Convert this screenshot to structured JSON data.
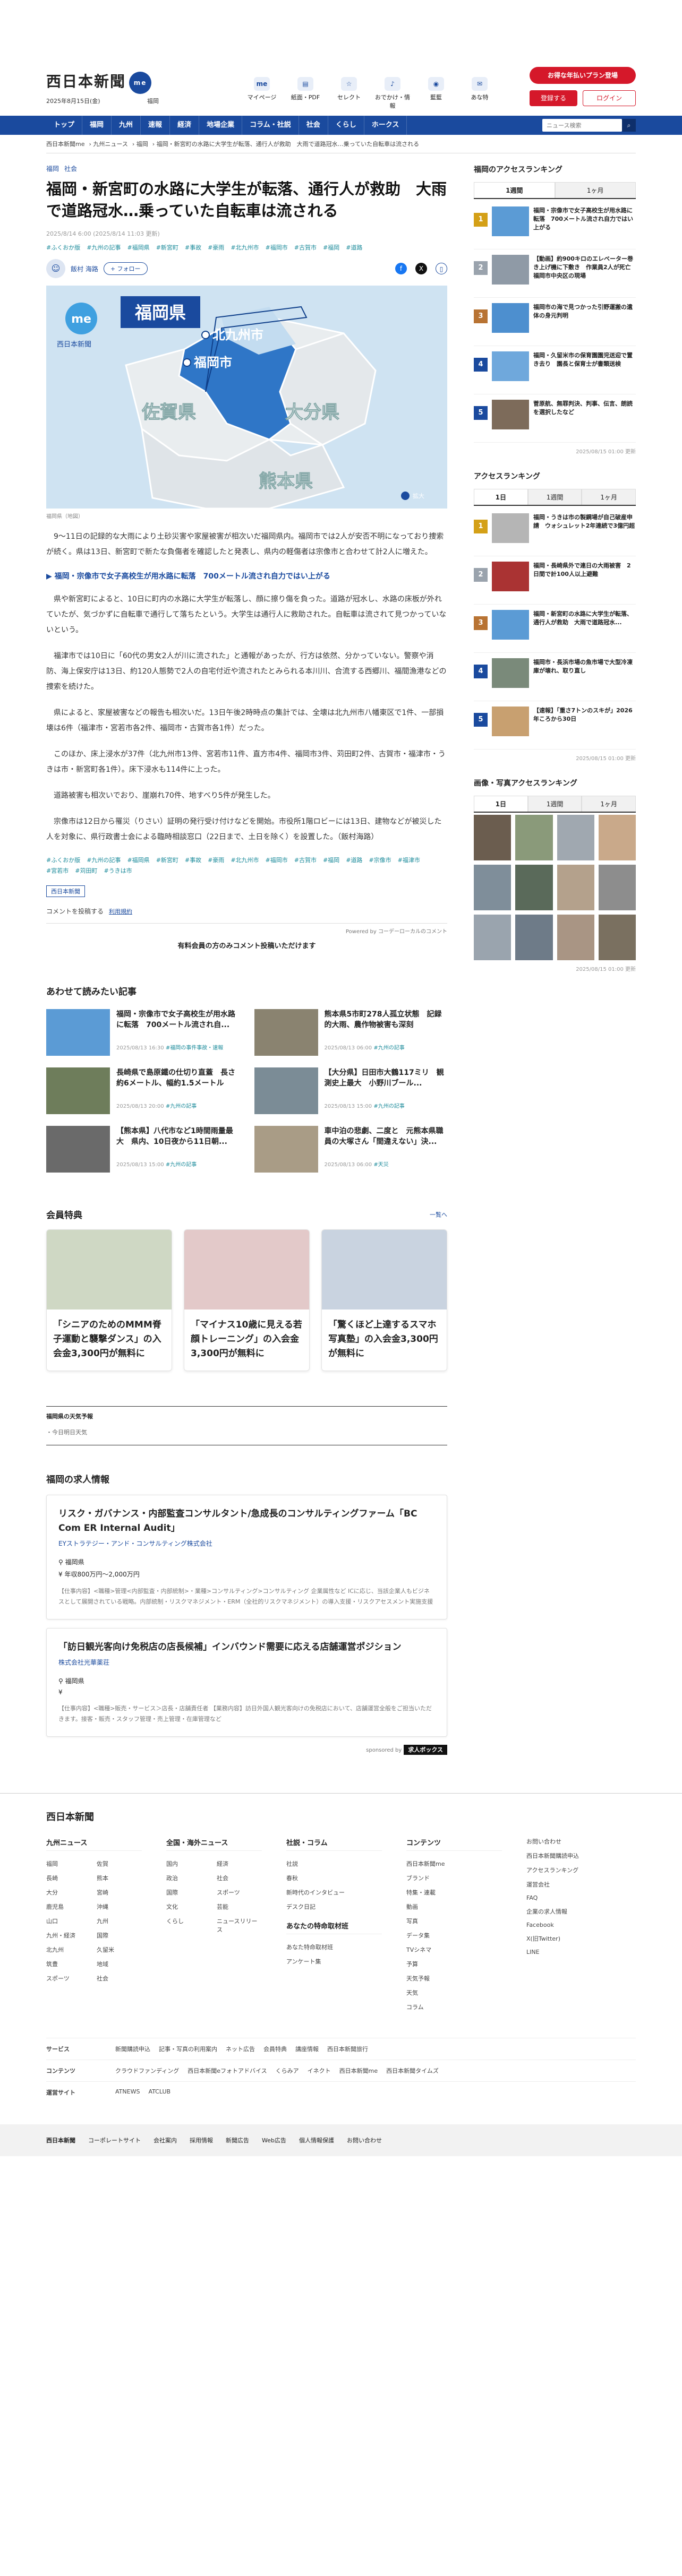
{
  "header": {
    "logo": "西日本新聞",
    "badge": "me",
    "date": "2025年8月15日(金)",
    "weather": "福岡",
    "icons": [
      {
        "label": "マイページ",
        "glyph": "me"
      },
      {
        "label": "紙面・PDF",
        "glyph": "▤"
      },
      {
        "label": "セレクト",
        "glyph": "☆"
      },
      {
        "label": "おでかけ・情報",
        "glyph": "♪"
      },
      {
        "label": "藍藍",
        "glyph": "◉"
      },
      {
        "label": "あな特",
        "glyph": "✉"
      }
    ],
    "cta": "お得な年払いプラン登場",
    "register": "登録する",
    "login": "ログイン"
  },
  "nav": {
    "items": [
      "トップ",
      "福岡",
      "九州",
      "速報",
      "経済",
      "地場企業",
      "コラム・社説",
      "社会",
      "くらし",
      "ホークス"
    ],
    "search_placeholder": "ニュース検索"
  },
  "breadcrumb": [
    "西日本新聞me",
    "九州ニュース",
    "福岡",
    "福岡・新宮町の水路に大学生が転落、通行人が救助　大雨で道路冠水…乗っていた自転車は流される"
  ],
  "article": {
    "categories": [
      "福岡",
      "社会"
    ],
    "title": "福岡・新宮町の水路に大学生が転落、通行人が救助　大雨で道路冠水…乗っていた自転車は流される",
    "pubdate": "2025/8/14 6:00 (2025/8/14 11:03 更新)",
    "tags": [
      "#ふくおか版",
      "#九州の記事",
      "#福岡県",
      "#新宮町",
      "#事故",
      "#豪雨",
      "#北九州市",
      "#福岡市",
      "#古賀市",
      "#福岡",
      "#道路"
    ],
    "author": "飯村 海路",
    "follow": "+ フォロー",
    "map": {
      "labels": [
        "福岡県",
        "北九州市",
        "福岡市",
        "佐賀県",
        "大分県",
        "熊本県"
      ],
      "caption_brand": "me 西日本新聞",
      "zoom": "拡大"
    },
    "caption": "福岡県（地図）",
    "p1": "9〜11日の記録的な大雨により土砂災害や家屋被害が相次いだ福岡県内。福岡市では2人が安否不明になっており捜索が続く。県は13日、新宮町で新たな負傷者を確認したと発表し、県内の軽傷者は宗像市と合わせて計2人に増えた。",
    "rel": "▶ 福岡・宗像市で女子高校生が用水路に転落　700メートル流され自力ではい上がる",
    "p2": "県や新宮町によると、10日に町内の水路に大学生が転落し、顔に擦り傷を負った。道路が冠水し、水路の床板が外れていたが、気づかずに自転車で通行して落ちたという。大学生は通行人に救助された。自転車は流されて見つかっていないという。",
    "p3": "福津市では10日に「60代の男女2人が川に流された」と通報があったが、行方は依然、分かっていない。警察や消防、海上保安庁は13日、約120人態勢で2人の自宅付近や流されたとみられる本川川、合流する西郷川、福間漁港などの捜索を続けた。",
    "p4": "県によると、家屋被害などの報告も相次いだ。13日午後2時時点の集計では、全壊は北九州市八幡東区で1件、一部損壊は6件（福津市・宮若市各2件、福岡市・古賀市各1件）だった。",
    "p5": "このほか、床上浸水が37件（北九州市13件、宮若市11件、直方市4件、福岡市3件、苅田町2件、古賀市・福津市・うきは市・新宮町各1件）。床下浸水も114件に上った。",
    "p6": "道路被害も相次いでおり、崖崩れ70件、地すべり5件が発生した。",
    "p7": "宗像市は12日から罹災（りさい）証明の発行受け付けなどを開始。市役所1階ロビーには13日、建物などが被災した人を対象に、県行政書士会による臨時相談窓口（22日まで、土日を除く）を設置した。（飯村海路）",
    "tags2": [
      "#ふくおか版",
      "#九州の記事",
      "#福岡県",
      "#新宮町",
      "#事故",
      "#豪雨",
      "#北九州市",
      "#福岡市",
      "#古賀市",
      "#福岡",
      "#道路",
      "#宗像市",
      "#福津市",
      "#宮若市",
      "#苅田町",
      "#うきは市"
    ],
    "tagbox": "西日本新聞",
    "comment": "コメントを投稿する",
    "comment_link": "利用規約",
    "powered": "Powered by コーデーローカルのコメント",
    "comment_note": "有料会員の方のみコメント投稿いただけます"
  },
  "related": {
    "heading": "あわせて読みたい記事",
    "items": [
      {
        "title": "福岡・宗像市で女子高校生が用水路に転落　700メートル流され自...",
        "date": "2025/08/13 16:30",
        "tag": "#福岡の事件事故・速報"
      },
      {
        "title": "熊本県5市町278人孤立状態　記録的大雨、農作物被害も深刻",
        "date": "2025/08/13 06:00",
        "tag": "#九州の記事"
      },
      {
        "title": "長崎県で島原鐵の仕切り直蓋　長さ約6メートル、幅約1.5メートル",
        "date": "2025/08/13 20:00",
        "tag": "#九州の記事"
      },
      {
        "title": "【大分県】日田市大鶴117ミリ　観測史上最大　小野川ブール...",
        "date": "2025/08/13 15:00",
        "tag": "#九州の記事"
      },
      {
        "title": "【熊本県】八代市など1時間雨量最大　県内、10日夜から11日朝...",
        "date": "2025/08/13 15:00",
        "tag": "#九州の記事"
      },
      {
        "title": "車中泊の悲劇、二度と　元熊本県職員の大塚さん「間違えない」決...",
        "date": "2025/08/13 06:00",
        "tag": "#天災"
      }
    ]
  },
  "members": {
    "heading": "会員特典",
    "more": "一覧へ",
    "items": [
      "「シニアのためのMMM脊子運動と襲撃ダンス」の入会金3,300円が無料に",
      "「マイナス10歳に見える若顔トレーニング」の入会金3,300円が無料に",
      "「驚くほど上達するスマホ写真塾」の入会金3,300円が無料に"
    ]
  },
  "weather": {
    "heading": "福岡県の天気予報",
    "text": "・今日明日天気"
  },
  "jobs": {
    "heading": "福岡の求人情報",
    "items": [
      {
        "title": "リスク・ガバナンス・内部監査コンサルタント/急成長のコンサルティングファーム「BC Com ER Internal Audit」",
        "company": "EYストラテジー・アンド・コンサルティング株式会社",
        "loc": "福岡県",
        "pay": "年収800万円〜2,000万円",
        "desc": "【仕事内容】<職種>管理<内部監査・内部統制>・業種>コンサルティング>コンサルティング 企業属性など ICに応じ、当該企業人もビジネスとして展開されている戦略。内部統制・リスクマネジメント・ERM（全社的リスクマネジメント）の導入支援・リスクアセスメント実施支援"
      },
      {
        "title": "「訪日観光客向け免税店の店長候補」インバウンド需要に応える店舗運営ポジション",
        "company": "株式会社光華薬荘",
        "loc": "福岡県",
        "pay": "",
        "desc": "【仕事内容】<職種>販売・サービス＞店長・店舗責任者 【業務内容】訪日外国人観光客向けの免税店において、店舗運営全般をご担当いただきます。接客・販売・スタッフ管理・売上管理・在庫管理など"
      }
    ],
    "sponsor": "sponsored by",
    "sponsor_brand": "求人ボックス"
  },
  "sidebar": {
    "access_heading": "福岡のアクセスランキング",
    "tabs1": [
      "1週間",
      "1ヶ月"
    ],
    "rank1": [
      "福岡・宗像市で女子高校生が用水路に転落　700メートル流され自力ではい上がる",
      "【動画】約900キロのエレベーター巻き上げ機に下敷き　作業員2人が死亡　福岡市中央区の現場",
      "福岡市の海で見つかった引野運搬の遺体の身元判明",
      "福岡・久留米市の保育園園児送迎で置き去り　園長と保育士が書類送検",
      "菅原航、無罪判決、判事、伝言、朗読を選択したなど"
    ],
    "stamp1": "2025/08/15 01:00 更新",
    "rank2_heading": "アクセスランキング",
    "tabs2": [
      "1日",
      "1週間",
      "1ヶ月"
    ],
    "rank2": [
      "福岡・うきは市の製鋼場が自己破産申請　ウォシュレット2年連続で3億円超",
      "福岡・長崎県外で連日の大雨被害　2日間で計100人以上避難",
      "福岡・新宮町の水路に大学生が転落、通行人が救助　大雨で道路冠水...",
      "福岡市・長浜市場の魚市場で大型冷凍庫が壊れ、取り直し",
      "【速報】「重さ7トンのスキが」2026年ころから30日"
    ],
    "stamp2": "2025/08/15 01:00 更新",
    "photo_heading": "画像・写真アクセスランキング",
    "tabs3": [
      "1日",
      "1週間",
      "1ヶ月"
    ],
    "stamp3": "2025/08/15 01:00 更新"
  },
  "footer": {
    "logo": "西日本新聞",
    "col1": {
      "h": "九州ニュース",
      "l": [
        "福岡",
        "佐賀",
        "長崎",
        "熊本",
        "大分",
        "宮崎",
        "鹿児島",
        "沖縄",
        "山口",
        "九州",
        "九州・経済",
        "国際",
        "北九州",
        "久留米",
        "筑豊",
        "地域",
        "スポーツ",
        "社会"
      ]
    },
    "col2": {
      "h": "全国・海外ニュース",
      "l": [
        "国内",
        "経済",
        "政治",
        "社会",
        "国際",
        "スポーツ",
        "文化",
        "芸能",
        "くらし",
        "ニュースリリース"
      ]
    },
    "col3": {
      "h": "社説・コラム",
      "l": [
        "社説",
        "春秋",
        "新時代のインタビュー",
        "デスク日記"
      ],
      "h2": "あなたの特命取材班",
      "l2": [
        "あなた特命取材班",
        "アンケート集"
      ]
    },
    "col4": {
      "h": "コンテンツ",
      "l": [
        "西日本新聞me",
        "ブランド",
        "特集・連載",
        "動画",
        "写真",
        "データ集",
        "TVシネマ",
        "予算",
        "天気予報",
        "天気",
        "コラム"
      ]
    },
    "col5": {
      "l": [
        "お問い合わせ",
        "西日本新聞購読申込",
        "アクセスランキング",
        "運営会社",
        "FAQ",
        "企業の求人情報",
        "Facebook",
        "X(旧Twitter)",
        "LINE"
      ]
    },
    "rows": [
      {
        "h": "サービス",
        "l": [
          "新聞購読申込",
          "記事・写真の利用案内",
          "ネット広告",
          "会員特典",
          "講座情報",
          "西日本新聞旅行"
        ]
      },
      {
        "h": "コンテンツ",
        "l": [
          "クラウドファンディング",
          "西日本新聞eフォトアドバイス",
          "くらみア",
          "イネクト",
          "西日本新聞me",
          "西日本新聞タイムズ"
        ]
      },
      {
        "h": "運営サイト",
        "l": [
          "ATNEWS",
          "ATCLUB"
        ]
      }
    ],
    "bottom": [
      "西日本新聞",
      "コーポレートサイト",
      "会社案内",
      "採用情報",
      "新聞広告",
      "Web広告",
      "個人情報保護",
      "お問い合わせ"
    ]
  }
}
